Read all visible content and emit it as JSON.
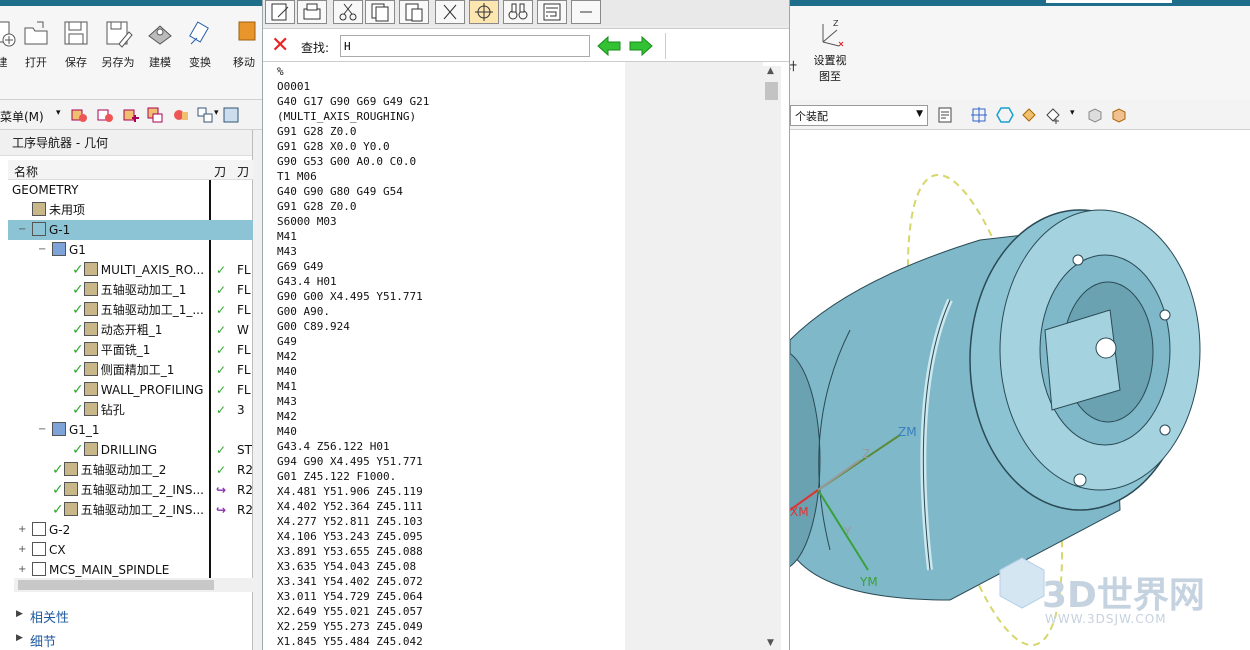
{
  "ribbon": {
    "buttons": [
      {
        "label": "建",
        "icon": "new-icon"
      },
      {
        "label": "打开",
        "icon": "open-icon"
      },
      {
        "label": "保存",
        "icon": "save-icon"
      },
      {
        "label": "另存为",
        "icon": "save-as-icon"
      },
      {
        "label": "建模",
        "icon": "modeling-icon"
      },
      {
        "label": "变换",
        "icon": "transform-icon"
      },
      {
        "label": "移动",
        "icon": "move-icon"
      }
    ],
    "right_buttons": [
      {
        "label": "计",
        "icon": "design-icon"
      },
      {
        "label": "设置视图至",
        "icon": "set-view-icon"
      }
    ]
  },
  "toolbar2": {
    "menu_label": "菜单(M)",
    "assembly_value": "个装配"
  },
  "navigator": {
    "title": "工序导航器 - 几何",
    "columns": [
      "名称",
      "刀",
      "刀"
    ],
    "rows": [
      {
        "name": "GEOMETRY",
        "c2": "",
        "c3": "",
        "indent": 0,
        "icon": "",
        "expander": "",
        "status": ""
      },
      {
        "name": "未用项",
        "c2": "",
        "c3": "",
        "indent": 1,
        "icon": "unused-folder-icon",
        "expander": "",
        "status": ""
      },
      {
        "name": "G-1",
        "c2": "",
        "c3": "",
        "indent": 1,
        "icon": "mcs-icon",
        "expander": "−",
        "status": "",
        "selected": true
      },
      {
        "name": "G1",
        "c2": "",
        "c3": "",
        "indent": 2,
        "icon": "workpiece-icon",
        "expander": "−",
        "status": ""
      },
      {
        "name": "MULTI_AXIS_RO...",
        "c2": "✓",
        "c3": "FL",
        "indent": 3,
        "icon": "multi-axis-icon",
        "expander": "",
        "status": "ok"
      },
      {
        "name": "五轴驱动加工_1",
        "c2": "✓",
        "c3": "FL",
        "indent": 3,
        "icon": "five-axis-icon",
        "expander": "",
        "status": "ok"
      },
      {
        "name": "五轴驱动加工_1_...",
        "c2": "✓",
        "c3": "FL",
        "indent": 3,
        "icon": "five-axis-icon",
        "expander": "",
        "status": "ok"
      },
      {
        "name": "动态开粗_1",
        "c2": "✓",
        "c3": "W",
        "indent": 3,
        "icon": "rough-icon",
        "expander": "",
        "status": "ok"
      },
      {
        "name": "平面铣_1",
        "c2": "✓",
        "c3": "FL",
        "indent": 3,
        "icon": "planar-mill-icon",
        "expander": "",
        "status": "ok"
      },
      {
        "name": "侧面精加工_1",
        "c2": "✓",
        "c3": "FL",
        "indent": 3,
        "icon": "side-finish-icon",
        "expander": "",
        "status": "ok"
      },
      {
        "name": "WALL_PROFILING",
        "c2": "✓",
        "c3": "FL",
        "indent": 3,
        "icon": "wall-profile-icon",
        "expander": "",
        "status": "ok"
      },
      {
        "name": "钻孔",
        "c2": "✓",
        "c3": "3",
        "indent": 3,
        "icon": "drill-icon",
        "expander": "",
        "status": "ok"
      },
      {
        "name": "G1_1",
        "c2": "",
        "c3": "",
        "indent": 2,
        "icon": "workpiece-icon",
        "expander": "−",
        "status": ""
      },
      {
        "name": "DRILLING",
        "c2": "✓",
        "c3": "ST",
        "indent": 3,
        "icon": "drilling-icon",
        "expander": "",
        "status": "ok"
      },
      {
        "name": "五轴驱动加工_2",
        "c2": "✓",
        "c3": "R2",
        "indent": 2,
        "icon": "five-axis-icon",
        "expander": "",
        "status": "ok"
      },
      {
        "name": "五轴驱动加工_2_INS...",
        "c2": "↪",
        "c3": "R2",
        "indent": 2,
        "icon": "five-axis-icon",
        "expander": "",
        "status": "ok"
      },
      {
        "name": "五轴驱动加工_2_INS...",
        "c2": "↪",
        "c3": "R2",
        "indent": 2,
        "icon": "five-axis-icon",
        "expander": "",
        "status": "ok"
      },
      {
        "name": "G-2",
        "c2": "",
        "c3": "",
        "indent": 1,
        "icon": "mcs-icon",
        "expander": "+",
        "status": ""
      },
      {
        "name": "CX",
        "c2": "",
        "c3": "",
        "indent": 1,
        "icon": "mcs-icon",
        "expander": "+",
        "status": ""
      },
      {
        "name": "MCS_MAIN_SPINDLE",
        "c2": "",
        "c3": "",
        "indent": 1,
        "icon": "mcs-icon",
        "expander": "+",
        "status": ""
      }
    ],
    "sections": [
      "相关性",
      "细节"
    ]
  },
  "editor": {
    "find_label": "查找:",
    "find_value": "H",
    "lines": [
      "%",
      "O0001",
      "G40 G17 G90 G69 G49 G21",
      "(MULTI_AXIS_ROUGHING)",
      "G91 G28 Z0.0",
      "G91 G28 X0.0 Y0.0",
      "G90 G53 G00 A0.0 C0.0",
      "T1 M06",
      "G40 G90 G80 G49 G54",
      "G91 G28 Z0.0",
      "S6000 M03",
      "M41",
      "M43",
      "G69 G49",
      "G43.4 H01",
      "G90 G00 X4.495 Y51.771",
      "G00 A90.",
      "G00 C89.924",
      "G49",
      "M42",
      "M40",
      "M41",
      "M43",
      "M42",
      "M40",
      "G43.4 Z56.122 H01",
      "G94 G90 X4.495 Y51.771",
      "G01 Z45.122 F1000.",
      "X4.481 Y51.906 Z45.119",
      "X4.402 Y52.364 Z45.111",
      "X4.277 Y52.811 Z45.103",
      "X4.106 Y53.243 Z45.095",
      "X3.891 Y53.655 Z45.088",
      "X3.635 Y54.043 Z45.08",
      "X3.341 Y54.402 Z45.072",
      "X3.011 Y54.729 Z45.064",
      "X2.649 Y55.021 Z45.057",
      "X2.259 Y55.273 Z45.049",
      "X1.845 Y55.484 Z45.042"
    ]
  },
  "viewport": {
    "axes": {
      "zm": "ZM",
      "z": "Z",
      "y": "Y",
      "ym": "YM",
      "xm": "XM"
    },
    "watermark": "3D世界网",
    "watermark_sub": "WWW.3DSJW.COM",
    "part_color": "#7fb8c8"
  }
}
